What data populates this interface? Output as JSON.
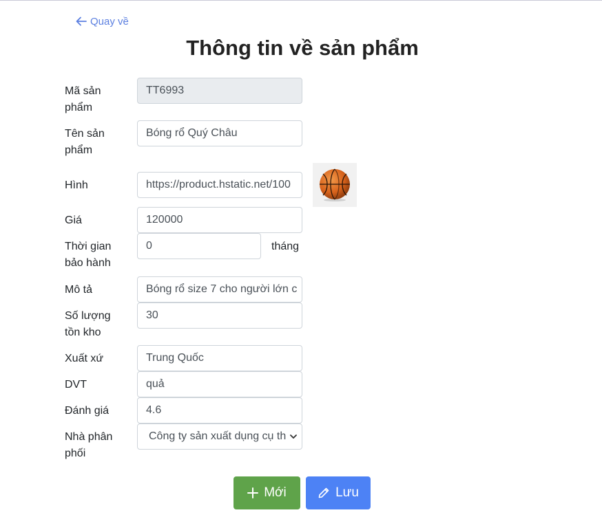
{
  "nav": {
    "back_label": "Quay về"
  },
  "page": {
    "title": "Thông tin về sản phẩm"
  },
  "form": {
    "product_code": {
      "label": "Mã sản phẩm",
      "value": "TT6993"
    },
    "product_name": {
      "label": "Tên sản phẩm",
      "value": "Bóng rổ Quý Châu"
    },
    "image": {
      "label": "Hình",
      "value": "https://product.hstatic.net/100"
    },
    "price": {
      "label": "Giá",
      "value": "120000"
    },
    "warranty": {
      "label": "Thời gian bảo hành",
      "value": "0",
      "suffix": "tháng"
    },
    "description": {
      "label": "Mô tả",
      "value": "Bóng rổ size 7 cho người lớn c"
    },
    "stock": {
      "label": "Số lượng tồn kho",
      "value": "30"
    },
    "origin": {
      "label": "Xuất xứ",
      "value": "Trung Quốc"
    },
    "unit": {
      "label": "DVT",
      "value": "quả"
    },
    "rating": {
      "label": "Đánh giá",
      "value": "4.6"
    },
    "distributor": {
      "label": "Nhà phân phối",
      "selected": "Công ty sản xuất dụng cụ th"
    }
  },
  "actions": {
    "new_label": "Mới",
    "save_label": "Lưu"
  },
  "colors": {
    "link": "#5b7fe0",
    "new_button": "#5fa34a",
    "save_button": "#4d82f5"
  },
  "icons": {
    "back": "arrow-left-icon",
    "new": "plus-icon",
    "save": "pencil-icon",
    "thumbnail": "basketball-image"
  }
}
